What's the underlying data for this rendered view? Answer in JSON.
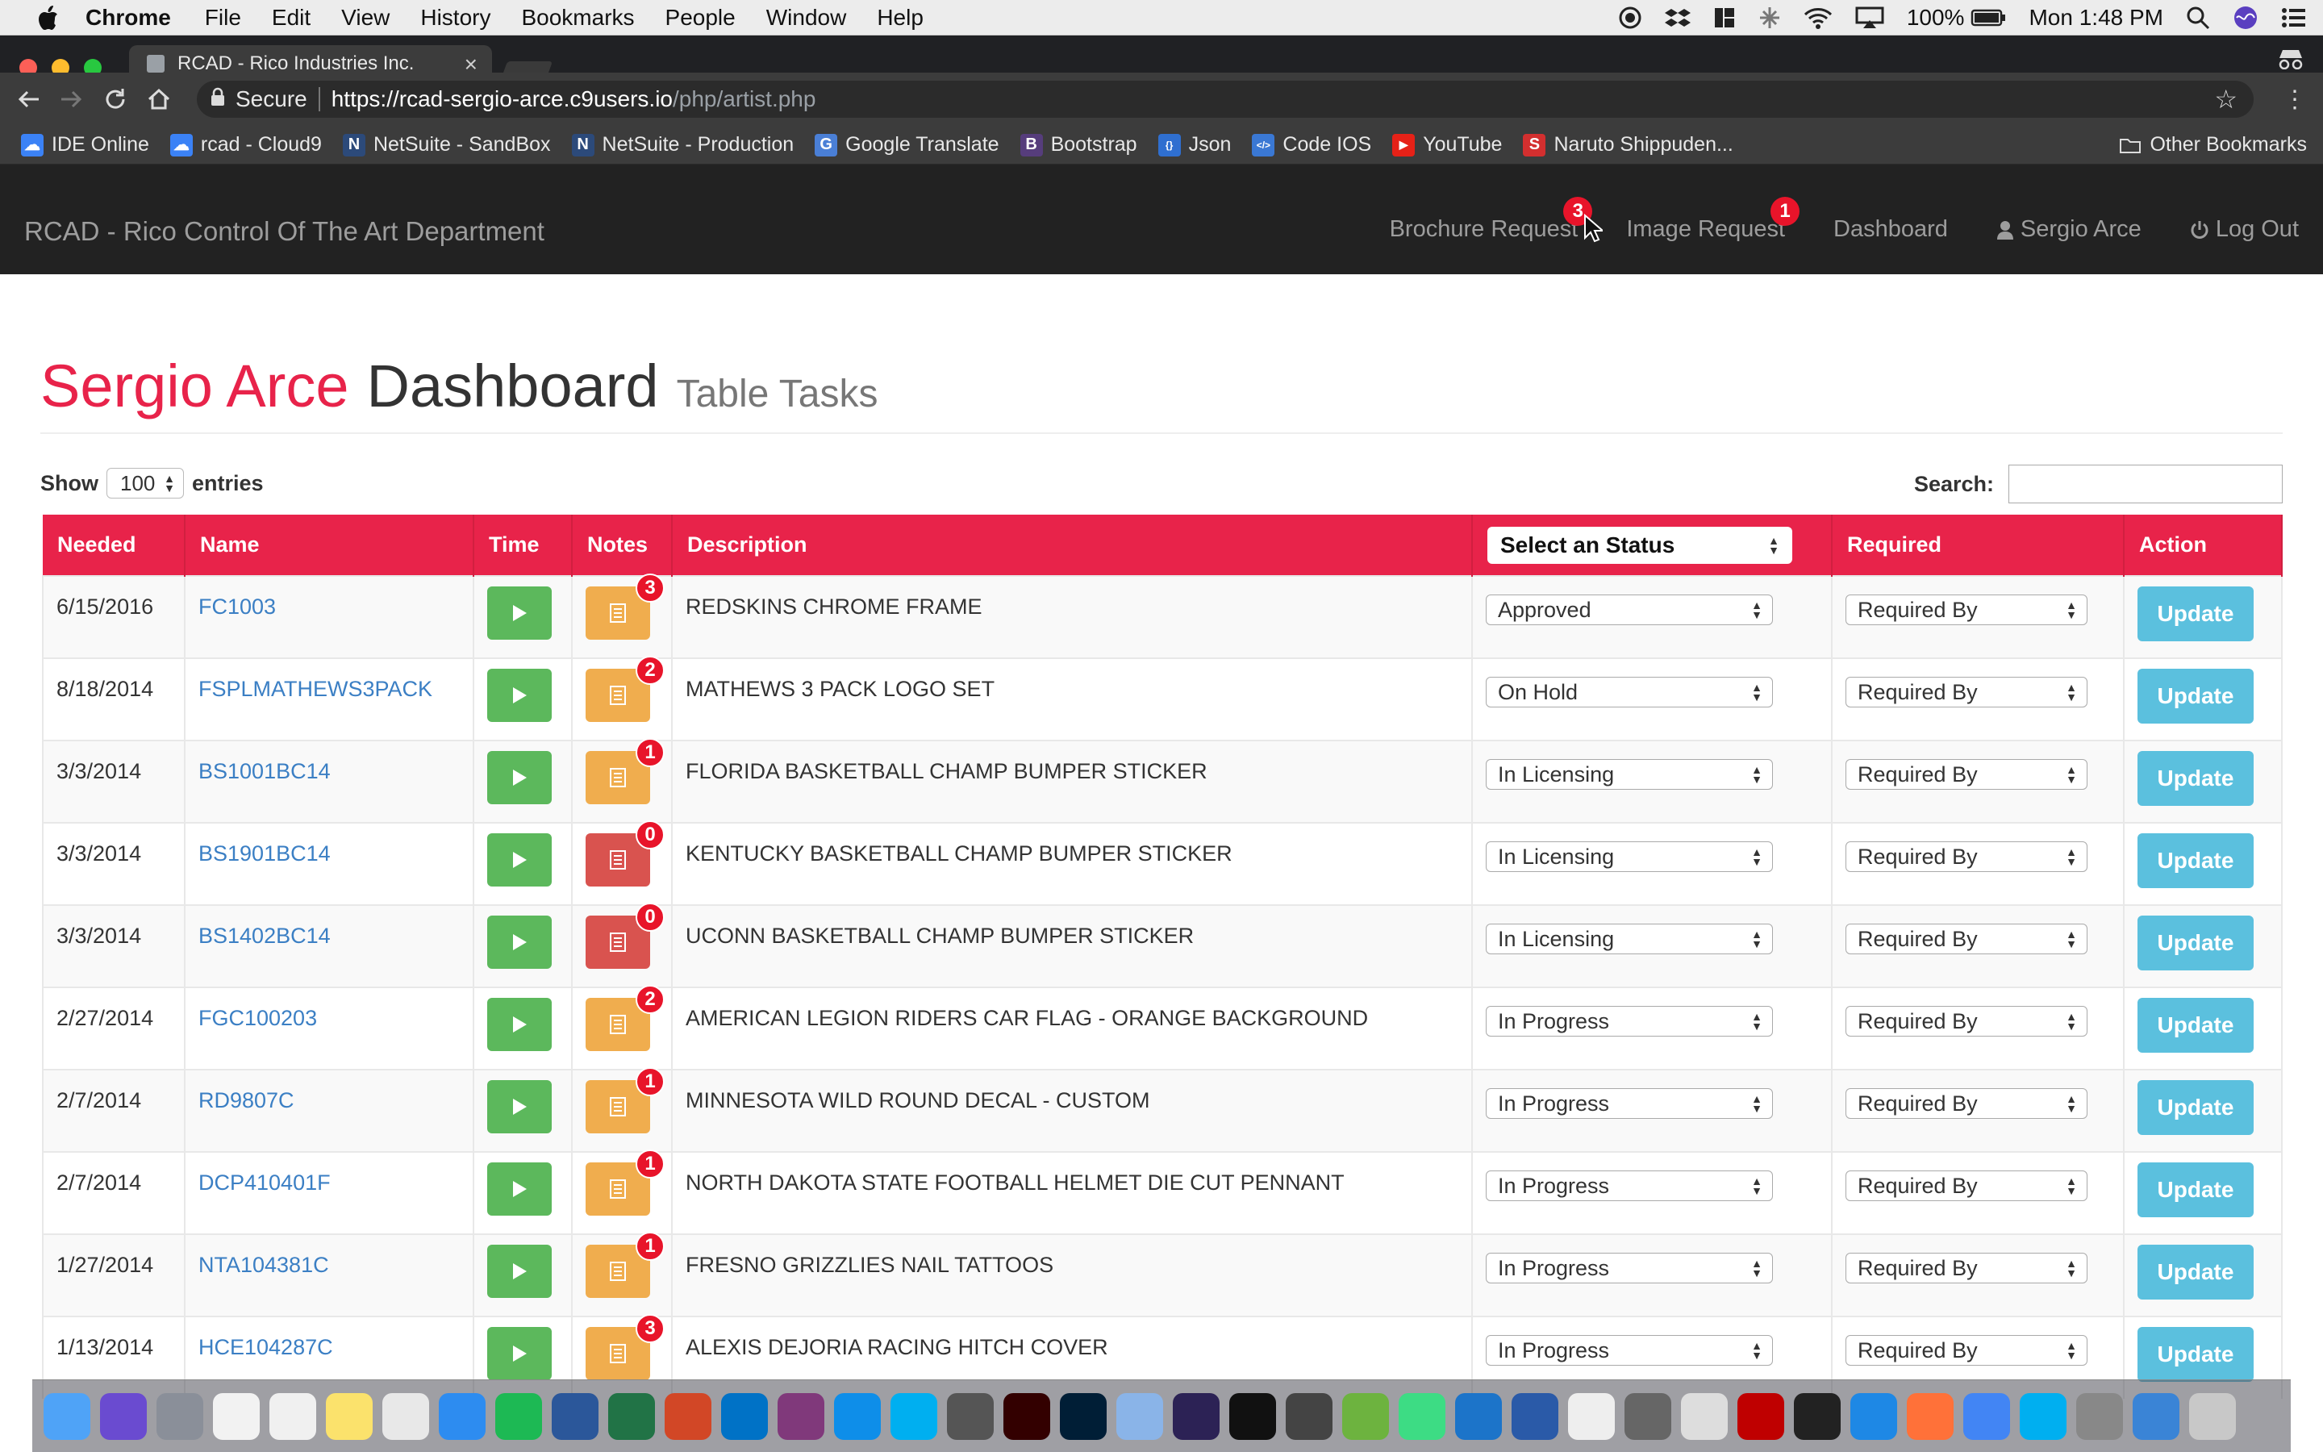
{
  "menubar": {
    "app": "Chrome",
    "items": [
      "File",
      "Edit",
      "View",
      "History",
      "Bookmarks",
      "People",
      "Window",
      "Help"
    ],
    "battery": "100%",
    "clock": "Mon 1:48 PM"
  },
  "browser": {
    "tab_title": "RCAD - Rico Industries Inc.",
    "secure_label": "Secure",
    "url_host": "https://rcad-sergio-arce.c9users.io",
    "url_path": "/php/artist.php",
    "bookmarks": [
      "IDE Online",
      "rcad - Cloud9",
      "NetSuite - SandBox",
      "NetSuite - Production",
      "Google Translate",
      "Bootstrap",
      "Json",
      "Code IOS",
      "YouTube",
      "Naruto Shippuden..."
    ],
    "other_bookmarks": "Other Bookmarks"
  },
  "nav": {
    "brand": "RCAD - Rico Control Of The Art Department",
    "brochure": "Brochure Request",
    "brochure_count": "3",
    "image": "Image Request",
    "image_count": "1",
    "dashboard": "Dashboard",
    "user": "Sergio Arce",
    "logout": "Log Out"
  },
  "page": {
    "user_name": "Sergio Arce",
    "title": "Dashboard",
    "subtitle": "Table Tasks",
    "show_label": "Show",
    "entries_value": "100",
    "entries_label": "entries",
    "search_label": "Search:"
  },
  "table": {
    "headers": {
      "needed": "Needed",
      "name": "Name",
      "time": "Time",
      "notes": "Notes",
      "description": "Description",
      "status": "Select an Status",
      "required": "Required",
      "action": "Action"
    },
    "required_placeholder": "Required By",
    "update_label": "Update",
    "rows": [
      {
        "needed": "6/15/2016",
        "name": "FC1003",
        "notes": "3",
        "description": "REDSKINS CHROME FRAME",
        "status": "Approved"
      },
      {
        "needed": "8/18/2014",
        "name": "FSPLMATHEWS3PACK",
        "notes": "2",
        "description": "MATHEWS 3 PACK LOGO SET",
        "status": "On Hold"
      },
      {
        "needed": "3/3/2014",
        "name": "BS1001BC14",
        "notes": "1",
        "description": "FLORIDA BASKETBALL CHAMP BUMPER STICKER",
        "status": "In Licensing"
      },
      {
        "needed": "3/3/2014",
        "name": "BS1901BC14",
        "notes": "0",
        "description": "KENTUCKY BASKETBALL CHAMP BUMPER STICKER",
        "status": "In Licensing"
      },
      {
        "needed": "3/3/2014",
        "name": "BS1402BC14",
        "notes": "0",
        "description": "UCONN BASKETBALL CHAMP BUMPER STICKER",
        "status": "In Licensing"
      },
      {
        "needed": "2/27/2014",
        "name": "FGC100203",
        "notes": "2",
        "description": "AMERICAN LEGION RIDERS CAR FLAG - ORANGE BACKGROUND",
        "status": "In Progress"
      },
      {
        "needed": "2/7/2014",
        "name": "RD9807C",
        "notes": "1",
        "description": "MINNESOTA WILD ROUND DECAL - CUSTOM",
        "status": "In Progress"
      },
      {
        "needed": "2/7/2014",
        "name": "DCP410401F",
        "notes": "1",
        "description": "NORTH DAKOTA STATE FOOTBALL HELMET DIE CUT PENNANT",
        "status": "In Progress"
      },
      {
        "needed": "1/27/2014",
        "name": "NTA104381C",
        "notes": "1",
        "description": "FRESNO GRIZZLIES NAIL TATTOOS",
        "status": "In Progress"
      },
      {
        "needed": "1/13/2014",
        "name": "HCE104287C",
        "notes": "3",
        "description": "ALEXIS DEJORIA RACING HITCH COVER",
        "status": "In Progress"
      }
    ]
  },
  "colors": {
    "accent": "#e8234a",
    "play": "#5cb85c",
    "notes_orange": "#f0ad4e",
    "notes_red": "#d9534f",
    "update": "#5bc0de",
    "link": "#3b7fc4"
  }
}
